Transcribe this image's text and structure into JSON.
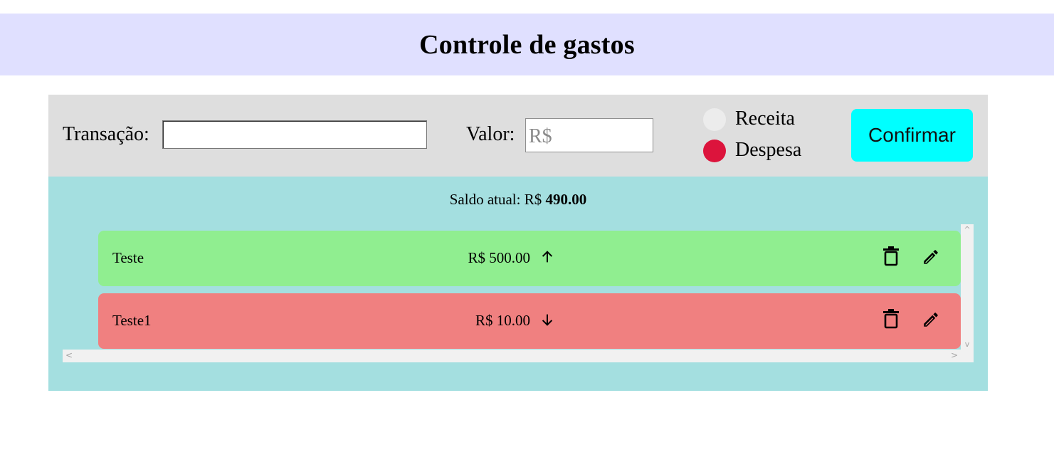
{
  "header": {
    "title": "Controle de gastos"
  },
  "form": {
    "transaction_label": "Transação:",
    "transaction_value": "",
    "value_label": "Valor:",
    "value_placeholder": "R$",
    "value_value": "",
    "type_options": [
      {
        "label": "Receita",
        "selected": false
      },
      {
        "label": "Despesa",
        "selected": true
      }
    ],
    "confirm_label": "Confirmar"
  },
  "balance": {
    "label": "Saldo atual: R$",
    "amount": "490.00"
  },
  "transactions": [
    {
      "name": "Teste",
      "amount": "R$ 500.00",
      "direction": "up",
      "color": "#90ee90",
      "direction_icon": "arrow-up-icon"
    },
    {
      "name": "Teste1",
      "amount": "R$ 10.00",
      "direction": "down",
      "color": "#f08080",
      "direction_icon": "arrow-down-icon"
    }
  ],
  "colors": {
    "header_bg": "#e0e0ff",
    "form_bg": "#dedede",
    "content_bg": "#a4dfe0",
    "confirm_bg": "#00ffff",
    "despesa_radio": "#dc143c",
    "income_row": "#90ee90",
    "expense_row": "#f08080"
  }
}
